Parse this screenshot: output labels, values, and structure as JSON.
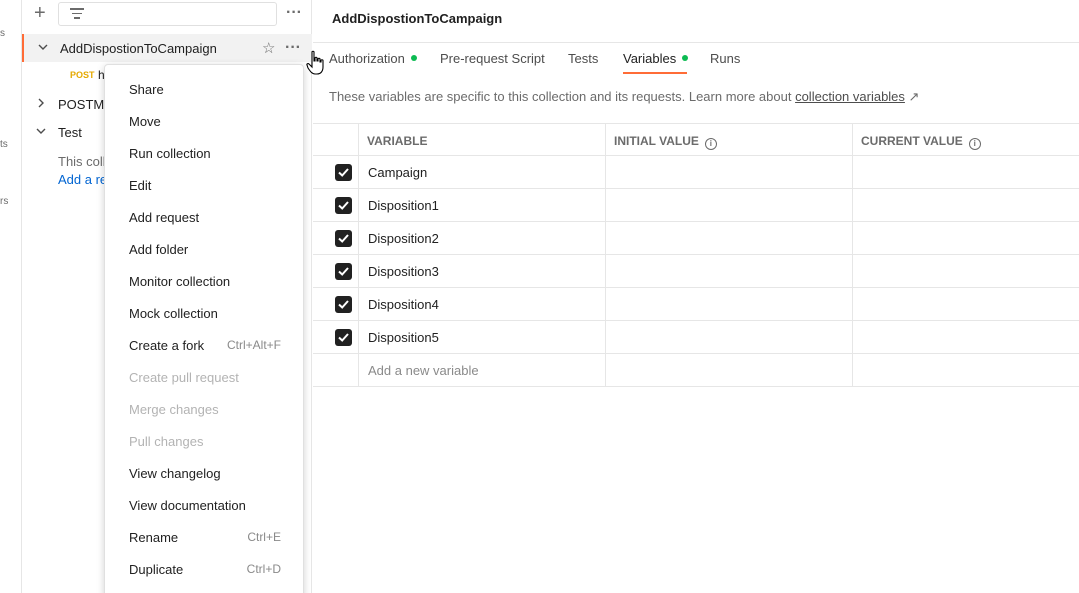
{
  "rail": {
    "labels": [
      "s",
      "ts",
      "rs"
    ]
  },
  "sidebar": {
    "collections": [
      {
        "label": "AddDispostionToCampaign",
        "expanded": true
      },
      {
        "label": "POSTMA",
        "expanded": false
      },
      {
        "label": "Test",
        "expanded": true
      }
    ],
    "request": {
      "method": "POST",
      "name": "h"
    },
    "test_empty_text": "This coll",
    "test_empty_link": "Add a re"
  },
  "menu": {
    "items": [
      {
        "label": "Share",
        "shortcut": "",
        "disabled": false
      },
      {
        "label": "Move",
        "shortcut": "",
        "disabled": false
      },
      {
        "label": "Run collection",
        "shortcut": "",
        "disabled": false
      },
      {
        "label": "Edit",
        "shortcut": "",
        "disabled": false
      },
      {
        "label": "Add request",
        "shortcut": "",
        "disabled": false
      },
      {
        "label": "Add folder",
        "shortcut": "",
        "disabled": false
      },
      {
        "label": "Monitor collection",
        "shortcut": "",
        "disabled": false
      },
      {
        "label": "Mock collection",
        "shortcut": "",
        "disabled": false
      },
      {
        "label": "Create a fork",
        "shortcut": "Ctrl+Alt+F",
        "disabled": false
      },
      {
        "label": "Create pull request",
        "shortcut": "",
        "disabled": true
      },
      {
        "label": "Merge changes",
        "shortcut": "",
        "disabled": true
      },
      {
        "label": "Pull changes",
        "shortcut": "",
        "disabled": true
      },
      {
        "label": "View changelog",
        "shortcut": "",
        "disabled": false
      },
      {
        "label": "View documentation",
        "shortcut": "",
        "disabled": false
      },
      {
        "label": "Rename",
        "shortcut": "Ctrl+E",
        "disabled": false
      },
      {
        "label": "Duplicate",
        "shortcut": "Ctrl+D",
        "disabled": false
      }
    ]
  },
  "main": {
    "title": "AddDispostionToCampaign",
    "tabs": [
      {
        "label": "Authorization",
        "dot": true
      },
      {
        "label": "Pre-request Script",
        "dot": false
      },
      {
        "label": "Tests",
        "dot": false
      },
      {
        "label": "Variables",
        "dot": true,
        "active": true
      },
      {
        "label": "Runs",
        "dot": false
      }
    ],
    "info_text": "These variables are specific to this collection and its requests. Learn more about ",
    "info_link": "collection variables",
    "info_arrow": "↗",
    "table": {
      "headers": {
        "variable": "VARIABLE",
        "initial": "INITIAL VALUE",
        "current": "CURRENT VALUE"
      },
      "info_glyph": "i",
      "rows": [
        {
          "checked": true,
          "variable": "Campaign",
          "initial": "",
          "current": ""
        },
        {
          "checked": true,
          "variable": "Disposition1",
          "initial": "",
          "current": ""
        },
        {
          "checked": true,
          "variable": "Disposition2",
          "initial": "",
          "current": ""
        },
        {
          "checked": true,
          "variable": "Disposition3",
          "initial": "",
          "current": ""
        },
        {
          "checked": true,
          "variable": "Disposition4",
          "initial": "",
          "current": ""
        },
        {
          "checked": true,
          "variable": "Disposition5",
          "initial": "",
          "current": ""
        }
      ],
      "add_placeholder": "Add a new variable"
    }
  },
  "colors": {
    "accent": "#ff6c37",
    "dot": "#0cbb52",
    "link": "#0265d2",
    "method_post": "#e5a900"
  }
}
